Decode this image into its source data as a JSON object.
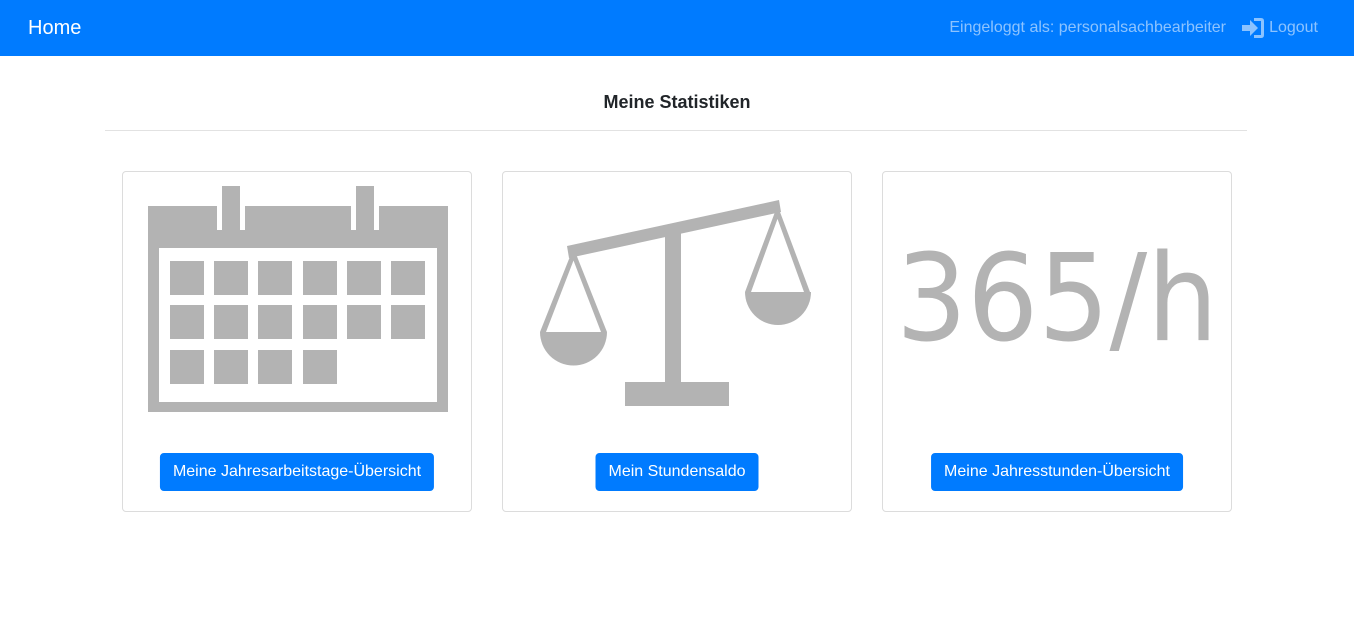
{
  "navbar": {
    "brand": "Home",
    "user_info": "Eingeloggt als: personalsachbearbeiter",
    "logout_label": "Logout"
  },
  "page": {
    "title": "Meine Statistiken"
  },
  "cards": [
    {
      "icon": "calendar-icon",
      "button_label": "Meine Jahresarbeitstage-Übersicht"
    },
    {
      "icon": "balance-scale-icon",
      "button_label": "Mein Stundensaldo"
    },
    {
      "icon": "hours-365-icon",
      "icon_text": "365/h",
      "button_label": "Meine Jahresstunden-Übersicht"
    }
  ],
  "colors": {
    "primary": "#007bff",
    "icon_gray": "#b3b3b3",
    "navbar_muted_text": "rgba(255,255,255,0.55)"
  }
}
